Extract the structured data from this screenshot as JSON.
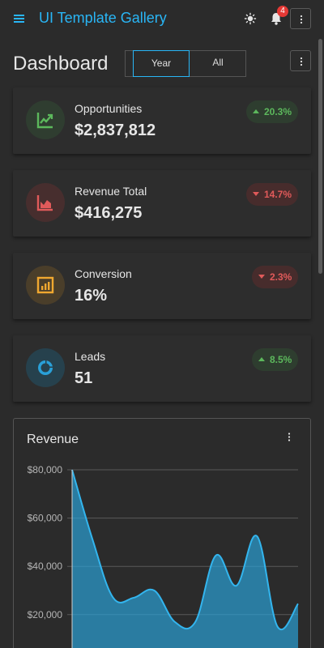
{
  "app": {
    "title": "UI Template Gallery",
    "notification_count": "4"
  },
  "dashboard": {
    "title": "Dashboard",
    "range_toggle": {
      "options": [
        "Year",
        "All"
      ],
      "selected": "Year"
    }
  },
  "kpis": [
    {
      "label": "Opportunities",
      "value": "$2,837,812",
      "delta": "20.3%",
      "trend": "up",
      "icon": "trending-up-icon",
      "color": "#5cb85c",
      "bg": "#2f3d30"
    },
    {
      "label": "Revenue Total",
      "value": "$416,275",
      "delta": "14.7%",
      "trend": "down",
      "icon": "area-chart-icon",
      "color": "#e05a5a",
      "bg": "#472e2e"
    },
    {
      "label": "Conversion",
      "value": "16%",
      "delta": "2.3%",
      "trend": "down",
      "icon": "bar-chart-icon",
      "color": "#f0a830",
      "bg": "#4a3e2a"
    },
    {
      "label": "Leads",
      "value": "51",
      "delta": "8.5%",
      "trend": "up",
      "icon": "donut-chart-icon",
      "color": "#29a0d8",
      "bg": "#26414d"
    }
  ],
  "revenue_card": {
    "title": "Revenue"
  },
  "colors": {
    "accent": "#29b6f6",
    "up": "#5cb85c",
    "down": "#e05a5a",
    "series": "#29a8e0"
  },
  "chart_data": {
    "type": "area",
    "title": "Revenue",
    "ylim": [
      0,
      80000
    ],
    "y_ticks": [
      "$80,000",
      "$60,000",
      "$40,000",
      "$20,000"
    ],
    "grid": true,
    "series": [
      {
        "values": [
          80000,
          51000,
          27000,
          27000,
          30000,
          17000,
          17000,
          44500,
          32000,
          52500,
          15000,
          24500
        ]
      }
    ]
  }
}
